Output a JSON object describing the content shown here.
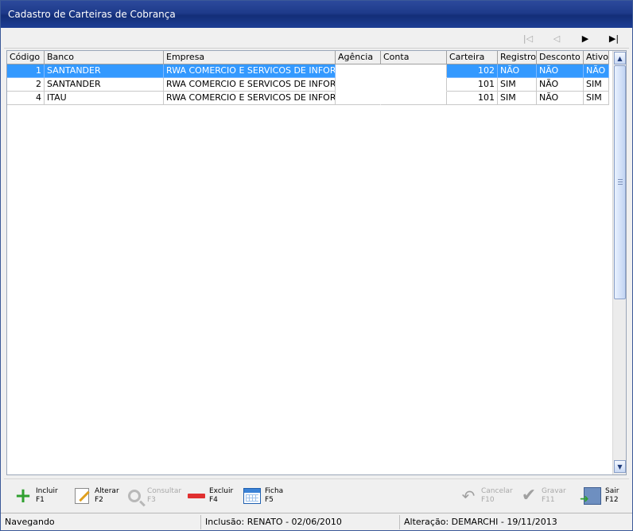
{
  "window": {
    "title": "Cadastro de Carteiras de Cobrança"
  },
  "nav": {
    "first": "first-record",
    "prev": "previous-record",
    "next": "next-record",
    "last": "last-record"
  },
  "grid": {
    "columns": [
      "Código",
      "Banco",
      "Empresa",
      "Agência",
      "Conta",
      "Carteira",
      "Registro",
      "Desconto",
      "Ativo"
    ],
    "rows": [
      {
        "codigo": "1",
        "banco": "SANTANDER",
        "empresa": "RWA COMERCIO E SERVICOS DE INFORM.",
        "agencia": "",
        "conta": "",
        "carteira": "102",
        "registro": "NÃO",
        "desconto": "NÃO",
        "ativo": "NÃO"
      },
      {
        "codigo": "2",
        "banco": "SANTANDER",
        "empresa": "RWA COMERCIO E SERVICOS DE INFORM.",
        "agencia": "",
        "conta": "",
        "carteira": "101",
        "registro": "SIM",
        "desconto": "NÃO",
        "ativo": "SIM"
      },
      {
        "codigo": "4",
        "banco": "ITAU",
        "empresa": "RWA COMERCIO E SERVICOS DE INFORM.",
        "agencia": "",
        "conta": "",
        "carteira": "101",
        "registro": "SIM",
        "desconto": "NÃO",
        "ativo": "SIM"
      }
    ]
  },
  "toolbar": {
    "incluir": {
      "label": "Incluir",
      "key": "F1"
    },
    "alterar": {
      "label": "Alterar",
      "key": "F2"
    },
    "consultar": {
      "label": "Consultar",
      "key": "F3"
    },
    "excluir": {
      "label": "Excluir",
      "key": "F4"
    },
    "ficha": {
      "label": "Ficha",
      "key": "F5"
    },
    "cancelar": {
      "label": "Cancelar",
      "key": "F10"
    },
    "gravar": {
      "label": "Gravar",
      "key": "F11"
    },
    "sair": {
      "label": "Sair",
      "key": "F12"
    }
  },
  "status": {
    "mode": "Navegando",
    "inclusao": "Inclusão: RENATO - 02/06/2010",
    "alteracao": "Alteração: DEMARCHI - 19/11/2013"
  },
  "colors": {
    "selection": "#3399ff",
    "titlebar": "#1e3a8a"
  }
}
